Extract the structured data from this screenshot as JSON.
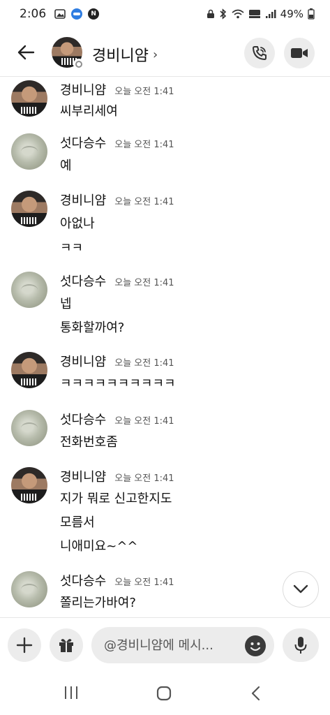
{
  "status_bar": {
    "time": "2:06",
    "battery": "49%",
    "left_icons": [
      "gallery-icon",
      "blue-badge-icon",
      "n-badge-icon"
    ],
    "right_icons": [
      "lock-icon",
      "bluetooth-icon",
      "wifi-icon",
      "hd-voice-icon",
      "signal-icon",
      "battery-icon"
    ]
  },
  "header": {
    "title": "경비니얌",
    "chevron": "›",
    "presence": "offline"
  },
  "messages": [
    {
      "sender": "경비니얌",
      "avatar": "user",
      "time": "오늘 오전 1:41",
      "lines": [
        "씨부리세여"
      ]
    },
    {
      "sender": "섯다승수",
      "avatar": "cat",
      "time": "오늘 오전 1:41",
      "lines": [
        "예"
      ]
    },
    {
      "sender": "경비니얌",
      "avatar": "user",
      "time": "오늘 오전 1:41",
      "lines": [
        "아없나",
        "ㅋㅋ"
      ]
    },
    {
      "sender": "섯다승수",
      "avatar": "cat",
      "time": "오늘 오전 1:41",
      "lines": [
        "넵",
        "통화할까여?"
      ]
    },
    {
      "sender": "경비니얌",
      "avatar": "user",
      "time": "오늘 오전 1:41",
      "lines": [
        "ㅋㅋㅋㅋㅋㅋㅋㅋㅋㅋ"
      ]
    },
    {
      "sender": "섯다승수",
      "avatar": "cat",
      "time": "오늘 오전 1:41",
      "lines": [
        "전화번호좀"
      ]
    },
    {
      "sender": "경비니얌",
      "avatar": "user",
      "time": "오늘 오전 1:41",
      "lines": [
        "지가 뭐로 신고한지도",
        "모름서",
        "니애미요~^^"
      ]
    },
    {
      "sender": "섯다승수",
      "avatar": "cat",
      "time": "오늘 오전 1:41",
      "lines": [
        "쫄리는가바여?"
      ]
    }
  ],
  "composer": {
    "placeholder": "@경비니얌에 메시..."
  },
  "colors": {
    "button_bg": "#ececec",
    "text": "#111111",
    "timestamp": "#555555",
    "divider": "#e6e6e6"
  }
}
